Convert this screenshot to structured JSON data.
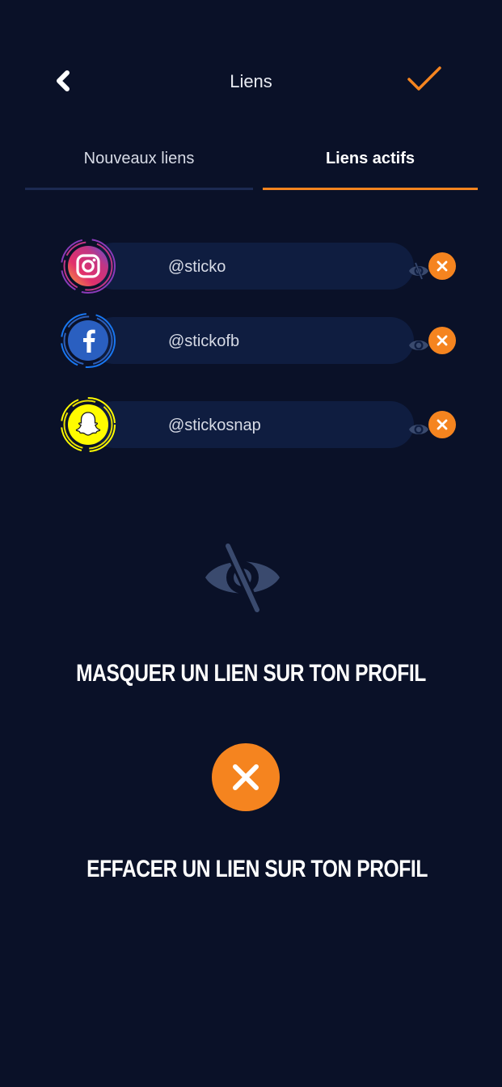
{
  "header": {
    "title": "Liens",
    "back_icon": "chevron-left-icon",
    "confirm_icon": "checkmark-icon"
  },
  "tabs": [
    {
      "label": "Nouveaux liens",
      "active": false
    },
    {
      "label": "Liens actifs",
      "active": true
    }
  ],
  "links": [
    {
      "network": "instagram",
      "icon": "instagram-icon",
      "handle": "@sticko",
      "visible": false
    },
    {
      "network": "facebook",
      "icon": "facebook-icon",
      "handle": "@stickofb",
      "visible": true
    },
    {
      "network": "snapchat",
      "icon": "snapchat-icon",
      "handle": "@stickosnap",
      "visible": true
    }
  ],
  "legend": {
    "hide_text": "MASQUER UN LIEN SUR TON PROFIL",
    "delete_text": "EFFACER UN LIEN SUR TON PROFIL"
  },
  "colors": {
    "background": "#0a1128",
    "accent": "#f5841f",
    "pill": "#0f1d40",
    "muted_icon": "#3a4a6e"
  }
}
